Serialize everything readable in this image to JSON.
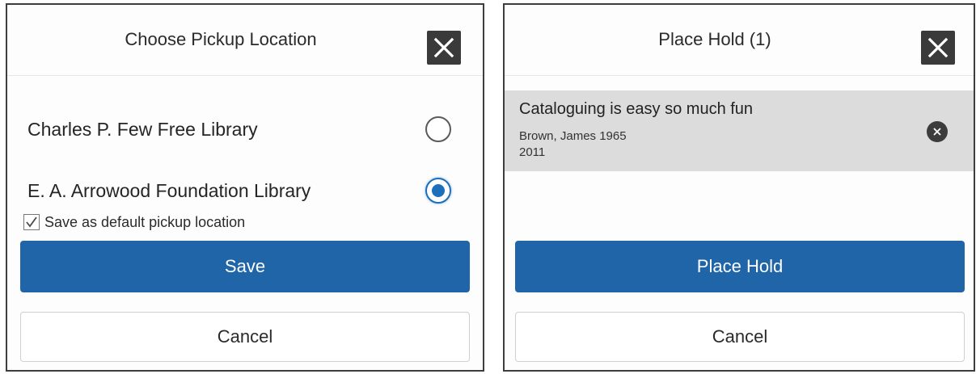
{
  "pickup_dialog": {
    "title": "Choose Pickup Location",
    "close_icon": "close-icon",
    "locations": [
      {
        "label": "Charles P. Few Free Library",
        "selected": false
      },
      {
        "label": "E. A. Arrowood Foundation Library",
        "selected": true
      }
    ],
    "default_checkbox": {
      "label": "Save as default pickup location",
      "checked": true
    },
    "save_label": "Save",
    "cancel_label": "Cancel"
  },
  "hold_dialog": {
    "title": "Place Hold (1)",
    "close_icon": "close-icon",
    "item": {
      "title": "Cataloguing is easy so much fun",
      "author": "Brown, James 1965",
      "year": "2011",
      "remove_icon": "remove-icon"
    },
    "place_hold_label": "Place Hold",
    "cancel_label": "Cancel"
  },
  "colors": {
    "primary": "#1f65a8",
    "radio_selected": "#1e6fba",
    "item_background": "#dcdcdc",
    "close_background": "#3a3a3a"
  }
}
